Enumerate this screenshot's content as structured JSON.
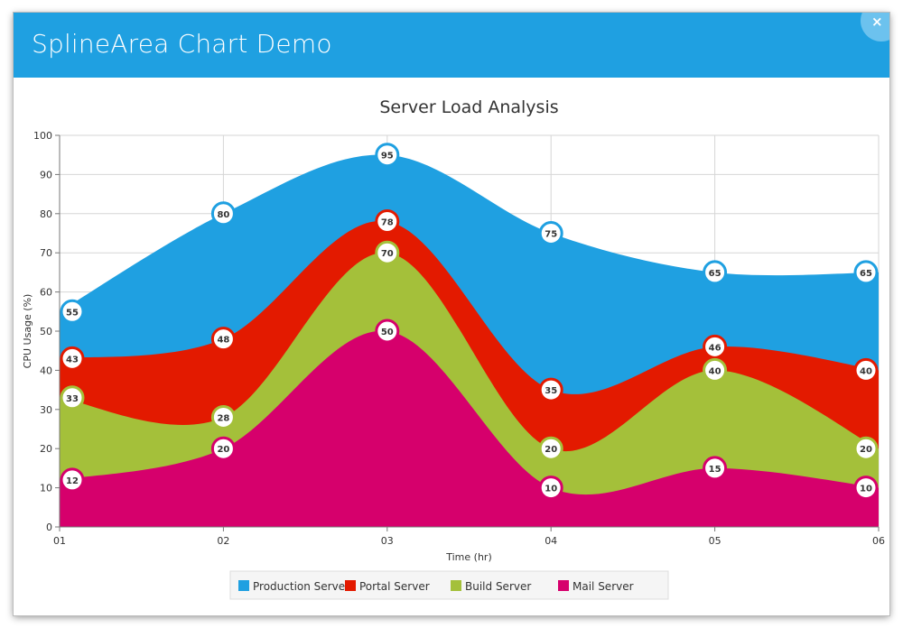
{
  "window": {
    "title": "SplineArea Chart Demo",
    "close_label": "×"
  },
  "chart_data": {
    "type": "area",
    "stacked": true,
    "spline": true,
    "title": "Server Load Analysis",
    "xlabel": "Time (hr)",
    "ylabel": "CPU Usage (%)",
    "ylim": [
      0,
      100
    ],
    "yticks": [
      0,
      10,
      20,
      30,
      40,
      50,
      60,
      70,
      80,
      90,
      100
    ],
    "categories": [
      "01",
      "02",
      "03",
      "04",
      "05",
      "06"
    ],
    "grid": true,
    "legend_position": "bottom",
    "series": [
      {
        "name": "Production Server",
        "color": "#1fa0e1",
        "values": [
          55,
          80,
          95,
          75,
          65,
          65
        ]
      },
      {
        "name": "Portal Server",
        "color": "#e31a00",
        "values": [
          43,
          48,
          78,
          35,
          46,
          40
        ]
      },
      {
        "name": "Build Server",
        "color": "#a4c03a",
        "values": [
          33,
          28,
          70,
          20,
          40,
          20
        ]
      },
      {
        "name": "Mail Server",
        "color": "#d6006c",
        "values": [
          12,
          20,
          50,
          10,
          15,
          10
        ]
      }
    ]
  }
}
